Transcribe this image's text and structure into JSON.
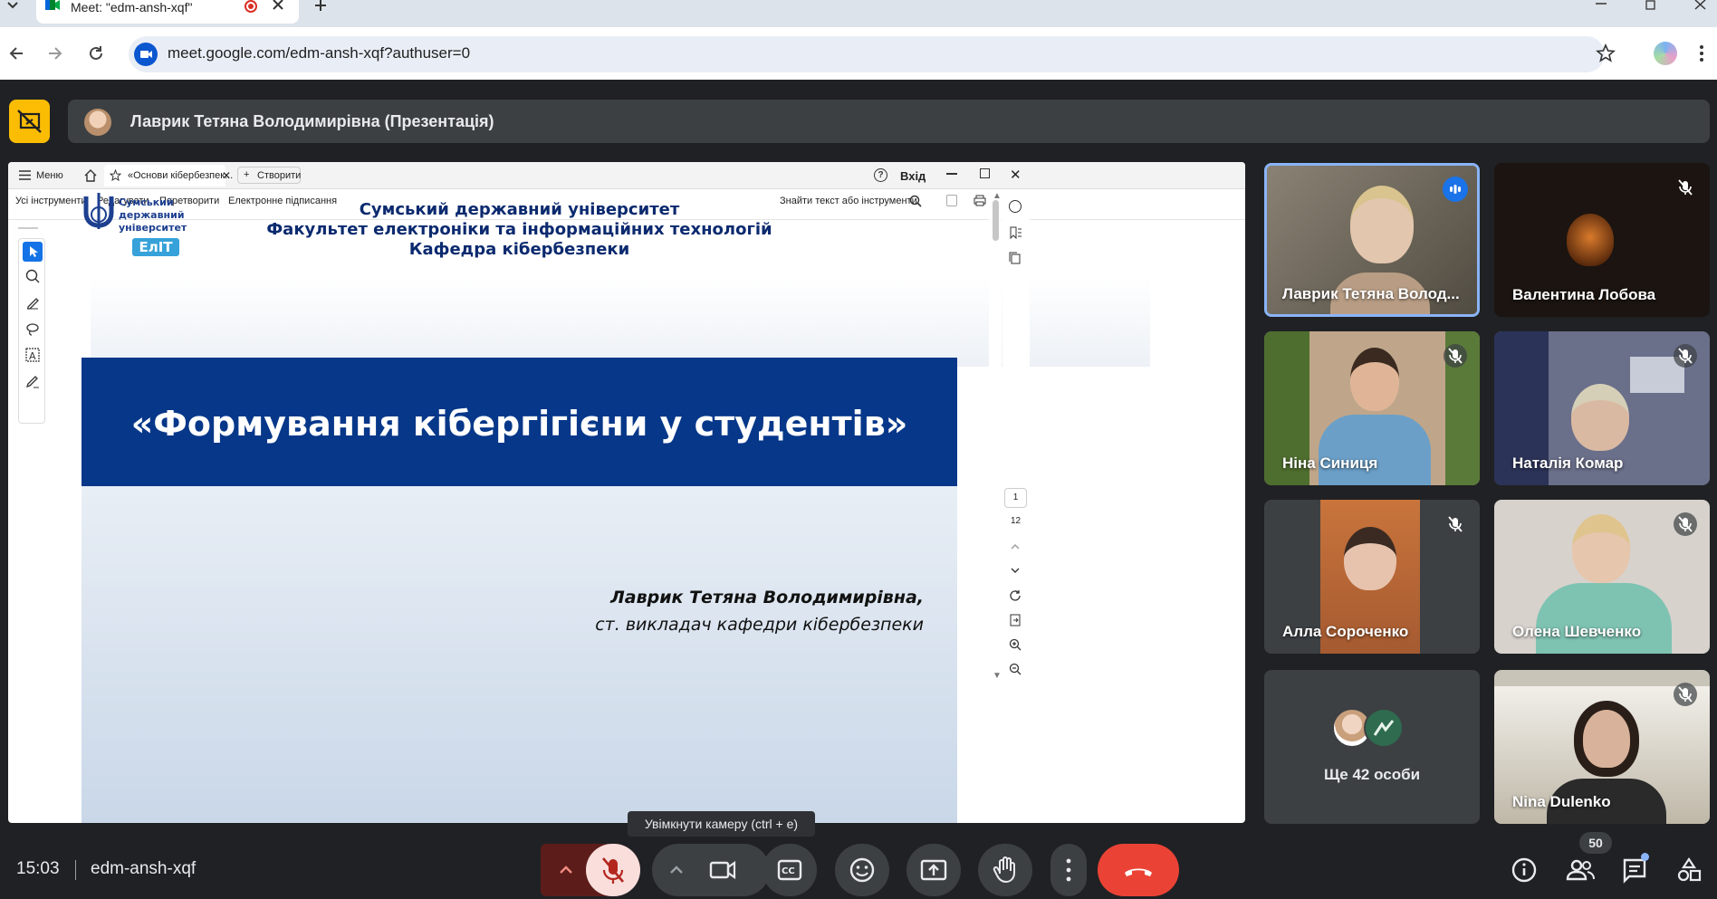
{
  "browser": {
    "tab_title": "Meet: \"edm-ansh-xqf\"",
    "url": "meet.google.com/edm-ansh-xqf?authuser=0"
  },
  "meet": {
    "presenter_label": "Лаврик Тетяна Володимирівна (Презентація)",
    "time": "15:03",
    "meeting_code": "edm-ansh-xqf",
    "camera_tooltip": "Увімкнути камеру (ctrl + e)",
    "participants_count": "50",
    "colors": {
      "accent": "#fbbc04",
      "end_call": "#ea4335",
      "mic_off": "#f9dedc",
      "active_border": "#8ab4f8"
    }
  },
  "pdf_viewer": {
    "menu_label": "Меню",
    "doc_tab": "«Основи кібербезпек...",
    "create_label": "Створити",
    "login_label": "Вхід",
    "menu_items": [
      "Усі інструменти",
      "Редагувати",
      "Перетворити",
      "Електронне підписання"
    ],
    "search_placeholder": "Знайти текст або інструменти",
    "page_current": "1",
    "page_total": "12"
  },
  "slide": {
    "logo_text": [
      "Сумський",
      "державний",
      "університет"
    ],
    "logo_badge": "ЕлІТ",
    "header_lines": [
      "Сумський державний університет",
      "Факультет електроніки та інформаційних технологій",
      "Кафедра кібербезпеки"
    ],
    "title": "«Формування кібергігієни у студентів»",
    "author": "Лаврик Тетяна Володимирівна,",
    "author_role": "ст. викладач кафедри кібербезпеки"
  },
  "participants": [
    {
      "name": "Лаврик Тетяна Волод...",
      "speaking": true
    },
    {
      "name": "Валентина Лобова",
      "muted": true
    },
    {
      "name": "Ніна Синиця",
      "muted": true
    },
    {
      "name": "Наталія Комар",
      "muted": true
    },
    {
      "name": "Алла Сороченко",
      "muted": true
    },
    {
      "name": "Олена Шевченко",
      "muted": true
    },
    {
      "name": "Ще 42 особи"
    },
    {
      "name": "Nina Dulenko",
      "muted": true
    }
  ]
}
